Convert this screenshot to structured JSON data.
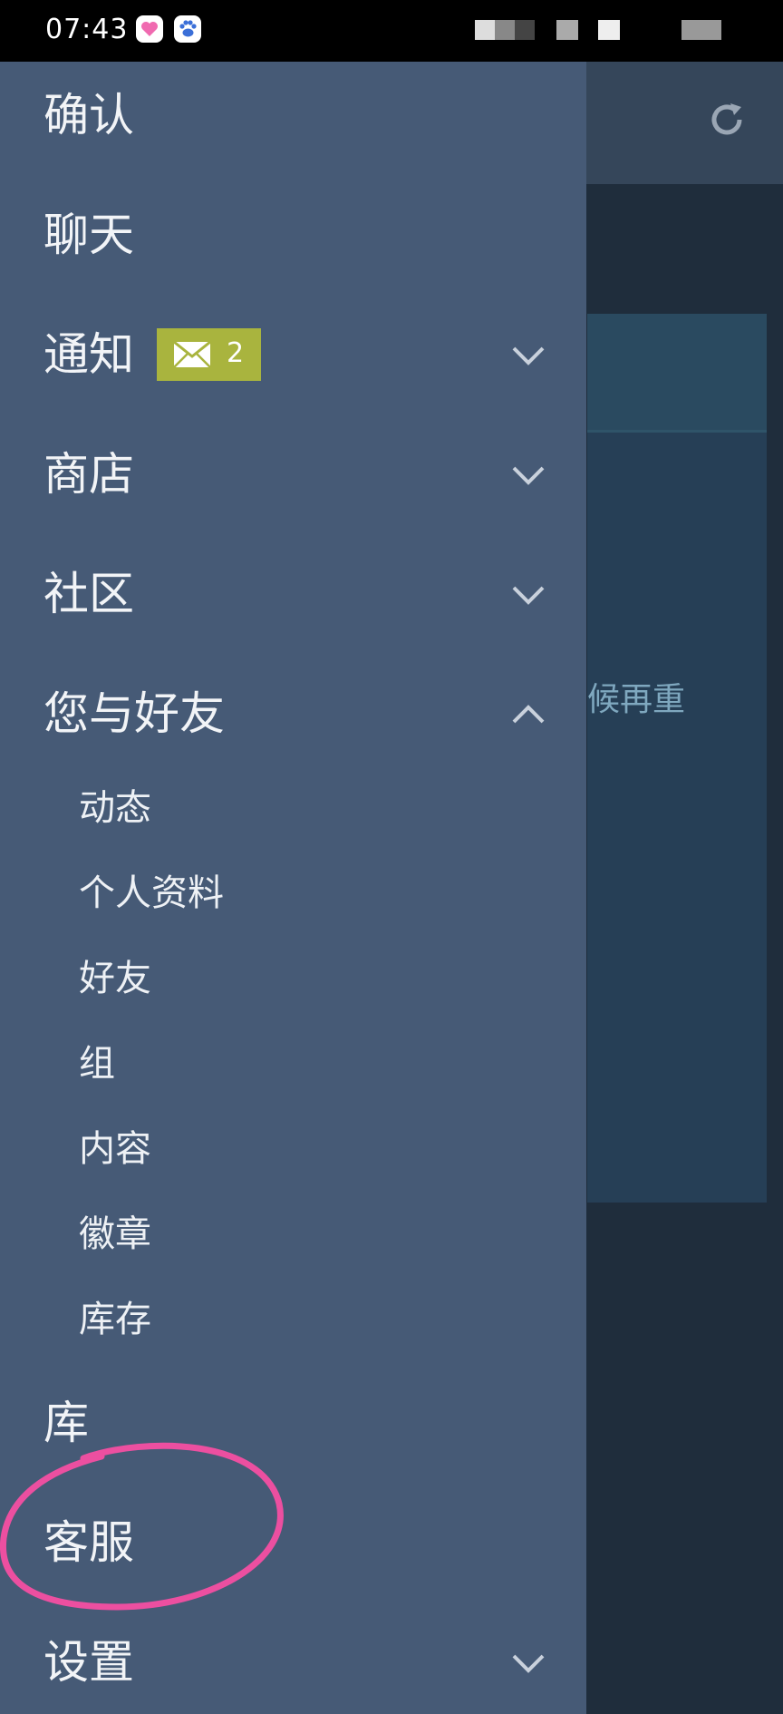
{
  "status_bar": {
    "time": "07:43",
    "app_icons": [
      "heart-app-icon",
      "paw-app-icon"
    ]
  },
  "drawer": {
    "items": [
      {
        "label": "确认"
      },
      {
        "label": "聊天"
      },
      {
        "label": "通知",
        "badge_count": "2",
        "chevron": "down"
      },
      {
        "label": "商店",
        "chevron": "down"
      },
      {
        "label": "社区",
        "chevron": "down"
      },
      {
        "label": "您与好友",
        "chevron": "up"
      },
      {
        "label": "库"
      },
      {
        "label": "客服"
      },
      {
        "label": "设置",
        "chevron": "down"
      }
    ],
    "subitems": [
      {
        "label": "动态"
      },
      {
        "label": "个人资料"
      },
      {
        "label": "好友"
      },
      {
        "label": "组"
      },
      {
        "label": "内容"
      },
      {
        "label": "徽章"
      },
      {
        "label": "库存"
      }
    ]
  },
  "background": {
    "partial_text": "候再重",
    "refresh_icon": "refresh-icon"
  },
  "colors": {
    "drawer_bg": "#465a76",
    "badge_bg": "#a9b43e",
    "highlight_circle": "#ec4fa0",
    "background": "#1f2d3c"
  }
}
